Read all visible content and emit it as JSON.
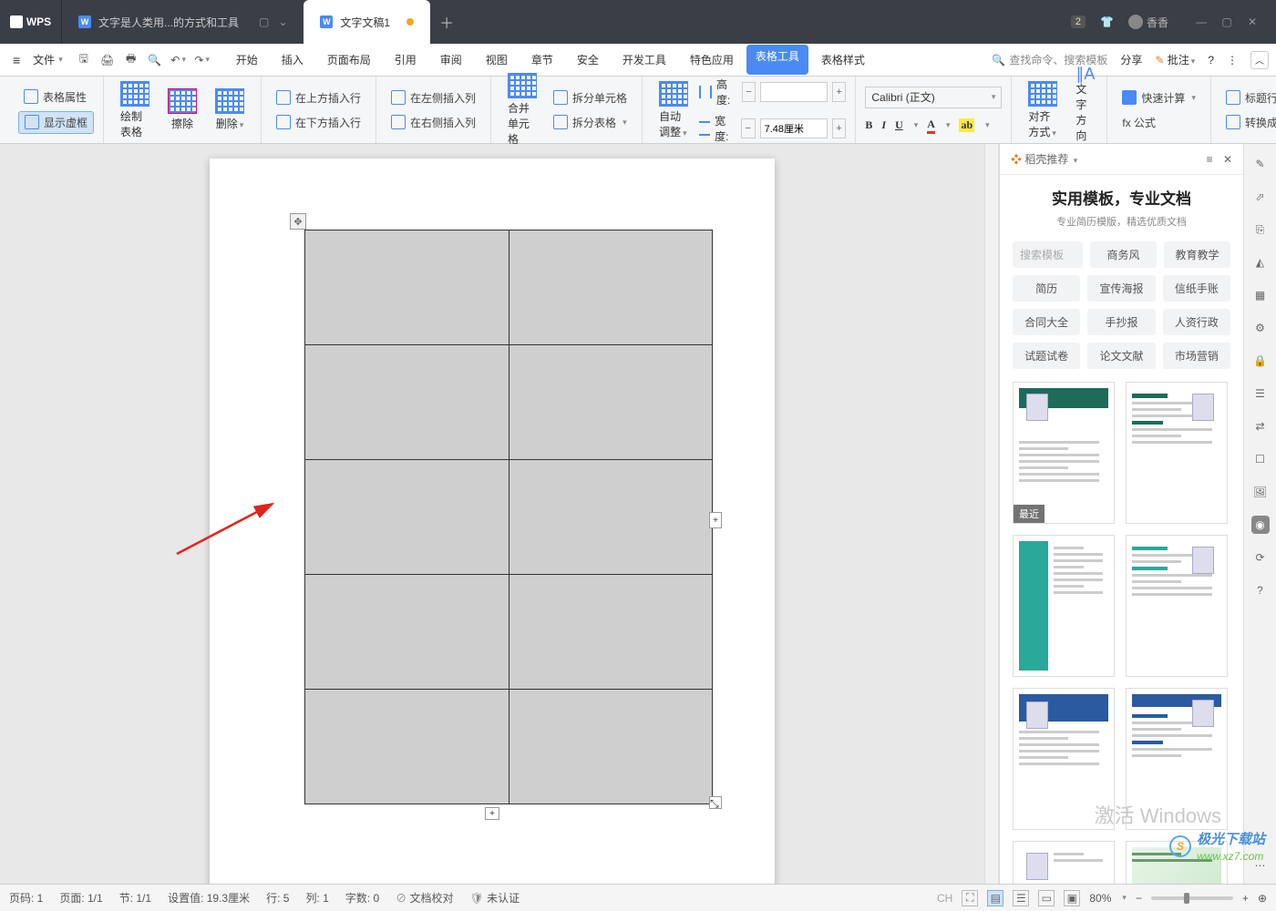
{
  "titlebar": {
    "logo": "WPS",
    "tab_inactive": "文字是人类用...的方式和工具",
    "tab_active": "文字文稿1",
    "badge": "2",
    "user": "香香"
  },
  "menubar": {
    "file": "文件",
    "tabs": [
      "开始",
      "插入",
      "页面布局",
      "引用",
      "审阅",
      "视图",
      "章节",
      "安全",
      "开发工具",
      "特色应用",
      "表格工具",
      "表格样式"
    ],
    "highlight_index": 10,
    "search_placeholder": "查找命令、搜索模板",
    "share": "分享",
    "comment": "批注"
  },
  "ribbon": {
    "table_prop": "表格属性",
    "show_frame": "显示虚框",
    "draw_table": "绘制表格",
    "erase": "擦除",
    "delete": "删除",
    "insert_above": "在上方插入行",
    "insert_below": "在下方插入行",
    "insert_left": "在左侧插入列",
    "insert_right": "在右侧插入列",
    "merge": "合并单元格",
    "split_cell": "拆分单元格",
    "split_table": "拆分表格",
    "auto_adjust": "自动调整",
    "height_lbl": "高度:",
    "height_val": "",
    "width_lbl": "宽度:",
    "width_val": "7.48厘米",
    "font": "Calibri (正文)",
    "align": "对齐方式",
    "text_dir": "文字方向",
    "fast_calc": "快速计算",
    "formula": "fx 公式",
    "repeat_header": "标题行重复",
    "to_text": "转换成文本"
  },
  "panel": {
    "header": "稻壳推荐",
    "title": "实用模板，专业文档",
    "sub": "专业简历模版，精选优质文档",
    "tags_row1": [
      "搜索模板",
      "商务风",
      "教育教学"
    ],
    "tags_row2": [
      "简历",
      "宣传海报",
      "信纸手账"
    ],
    "tags_row3": [
      "合同大全",
      "手抄报",
      "人资行政"
    ],
    "tags_row4": [
      "试题试卷",
      "论文文献",
      "市场营销"
    ],
    "recent": "最近"
  },
  "status": {
    "page_no": "页码: 1",
    "page": "页面: 1/1",
    "section": "节: 1/1",
    "setting": "设置值: 19.3厘米",
    "row": "行: 5",
    "col": "列: 1",
    "words": "字数: 0",
    "proof": "文档校对",
    "cert": "未认证",
    "zoom": "80%",
    "ime": "CH"
  },
  "watermark": {
    "windows": "激活 Windows",
    "site_name": "极光下载站",
    "site_url": "www.xz7.com"
  }
}
